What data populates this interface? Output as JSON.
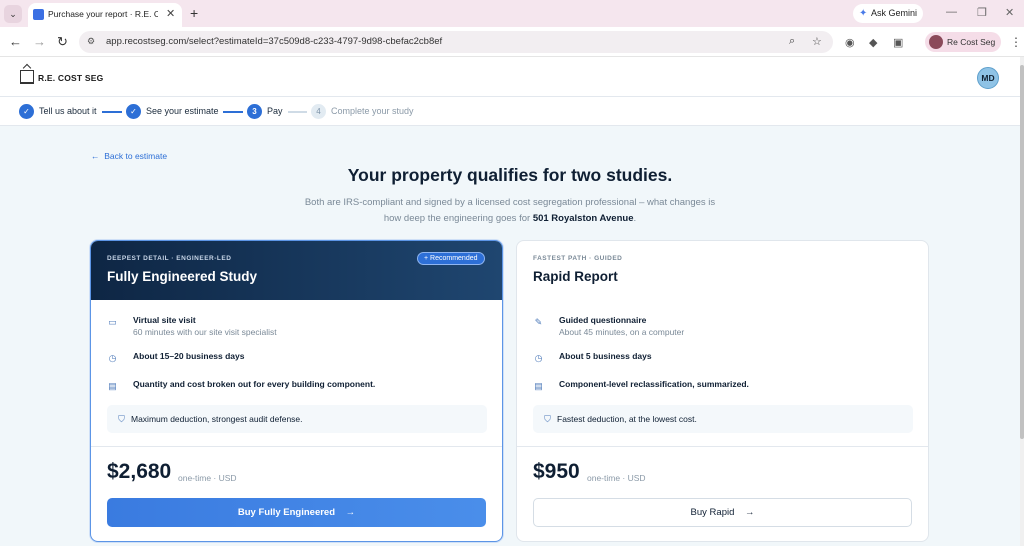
{
  "browser": {
    "tab_title": "Purchase your report · R.E. Cost",
    "url": "app.recostseg.com/select?estimateId=37c509d8-c233-4797-9d98-cbefac2cb8ef",
    "gemini_label": "Ask Gemini",
    "profile_name": "Re Cost Seg"
  },
  "header": {
    "logo_text": "R.E. COST SEG",
    "user_initials": "MD"
  },
  "stepper": {
    "steps": [
      {
        "label": "Tell us about it",
        "num": "✓",
        "state": "done"
      },
      {
        "label": "See your estimate",
        "num": "✓",
        "state": "done"
      },
      {
        "label": "Pay",
        "num": "3",
        "state": "current"
      },
      {
        "label": "Complete your study",
        "num": "4",
        "state": "upcoming"
      }
    ]
  },
  "page": {
    "back_link": "Back to estimate",
    "title": "Your property qualifies for two studies.",
    "subtitle": "Both are IRS-compliant and signed by a licensed cost segregation professional – what changes is how deep the engineering goes for",
    "address": "501 Royalston Avenue",
    "subtitle_end": "."
  },
  "cards": [
    {
      "eyebrow": "DEEPEST DETAIL · ENGINEER-LED",
      "title": "Fully Engineered Study",
      "badge": "+ Recommended",
      "features": [
        {
          "title": "Virtual site visit",
          "sub": "60 minutes with our site visit specialist",
          "icon": "video-icon"
        },
        {
          "title": "About 15–20 business days",
          "sub": "",
          "icon": "clock-icon"
        },
        {
          "title": "Quantity and cost broken out for every building component.",
          "sub": "",
          "icon": "document-icon"
        }
      ],
      "note": "Maximum deduction, strongest audit defense.",
      "price": "$2,680",
      "price_note": "one-time · USD",
      "button": "Buy Fully Engineered"
    },
    {
      "eyebrow": "FASTEST PATH · GUIDED",
      "title": "Rapid Report",
      "badge": "",
      "features": [
        {
          "title": "Guided questionnaire",
          "sub": "About 45 minutes, on a computer",
          "icon": "pencil-icon"
        },
        {
          "title": "About 5 business days",
          "sub": "",
          "icon": "clock-icon"
        },
        {
          "title": "Component-level reclassification, summarized.",
          "sub": "",
          "icon": "document-icon"
        }
      ],
      "note": "Fastest deduction, at the lowest cost.",
      "price": "$950",
      "price_note": "one-time · USD",
      "button": "Buy Rapid"
    }
  ],
  "colors": {
    "accent": "#2d6fd6",
    "card_dark": "#0e2644",
    "page_bg": "#f1f7fa"
  }
}
